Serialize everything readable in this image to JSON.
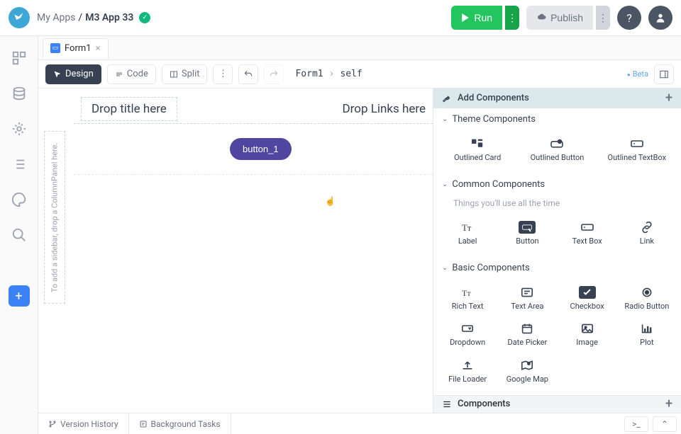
{
  "header": {
    "breadcrumb_root": "My Apps",
    "breadcrumb_sep": "/",
    "app_name": "M3 App 33",
    "run_label": "Run",
    "publish_label": "Publish",
    "status": "saved"
  },
  "tabs": [
    {
      "label": "Form1"
    }
  ],
  "toolbar": {
    "design": "Design",
    "code": "Code",
    "split": "Split",
    "path_form": "Form1",
    "path_chevron": "›",
    "path_self": "self",
    "beta": "Beta"
  },
  "canvas": {
    "sidebar_drop": "To add a sidebar, drop a ColumnPanel here.",
    "title_drop": "Drop title here",
    "links_drop": "Drop Links here",
    "button_label": "button_1"
  },
  "rpanel": {
    "add_components": "Add Components",
    "theme_section": "Theme Components",
    "theme_items": [
      {
        "label": "Outlined Card"
      },
      {
        "label": "Outlined Button"
      },
      {
        "label": "Outlined TextBox"
      }
    ],
    "common_section": "Common Components",
    "common_hint": "Things you'll use all the time",
    "common_items": [
      {
        "label": "Label"
      },
      {
        "label": "Button"
      },
      {
        "label": "Text Box"
      },
      {
        "label": "Link"
      }
    ],
    "basic_section": "Basic Components",
    "basic_items": [
      {
        "label": "Rich Text"
      },
      {
        "label": "Text Area"
      },
      {
        "label": "Checkbox"
      },
      {
        "label": "Radio Button"
      },
      {
        "label": "Dropdown"
      },
      {
        "label": "Date Picker"
      },
      {
        "label": "Image"
      },
      {
        "label": "Plot"
      },
      {
        "label": "File Loader"
      },
      {
        "label": "Google Map"
      }
    ],
    "bottom_label": "Components"
  },
  "footer": {
    "version_history": "Version History",
    "background_tasks": "Background Tasks"
  }
}
